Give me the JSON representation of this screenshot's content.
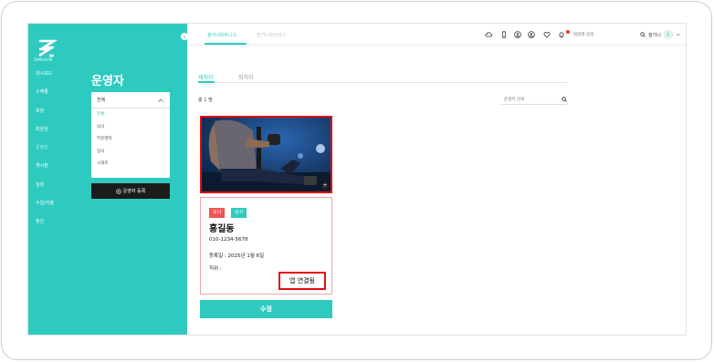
{
  "brand": {
    "logo_text": "ZIMGAYN"
  },
  "sidebar": {
    "collapse_label": "«",
    "items": [
      {
        "label": "대시보드",
        "active": false
      },
      {
        "label": "스케줄",
        "active": false
      },
      {
        "label": "회원",
        "active": false
      },
      {
        "label": "회원권",
        "active": false
      },
      {
        "label": "운영진",
        "active": true
      },
      {
        "label": "게시판",
        "active": false
      },
      {
        "label": "설정",
        "active": false
      },
      {
        "label": "수입/지출",
        "active": false
      },
      {
        "label": "정산",
        "active": false
      }
    ],
    "title": "운영자",
    "filter": {
      "selected": "전체",
      "options": [
        "전체",
        "오너",
        "부운영자",
        "강사",
        "스태프"
      ]
    },
    "register_button": "운영자 등록"
  },
  "header": {
    "gym_tabs": [
      "짐가니피트니스",
      "짐가니필라테스"
    ],
    "member_search_placeholder": "회원명 검색",
    "user_name": "짐가니",
    "avatar_text": "짐"
  },
  "main": {
    "tabs": [
      "재직자",
      "퇴직자"
    ],
    "total_count": "총 1 명",
    "search_placeholder": "운영자 검색",
    "card": {
      "badges": [
        "오너",
        "강사"
      ],
      "name": "홍길동",
      "phone": "010-1234-5678",
      "register_date": "등록일 : 2025년 1월 6일",
      "position": "직위 :",
      "app_status": "앱 연결됨",
      "edit_button": "수정"
    }
  },
  "colors": {
    "accent": "#2ecabf",
    "highlight": "#e10d0d",
    "owner_badge": "#f05555"
  }
}
